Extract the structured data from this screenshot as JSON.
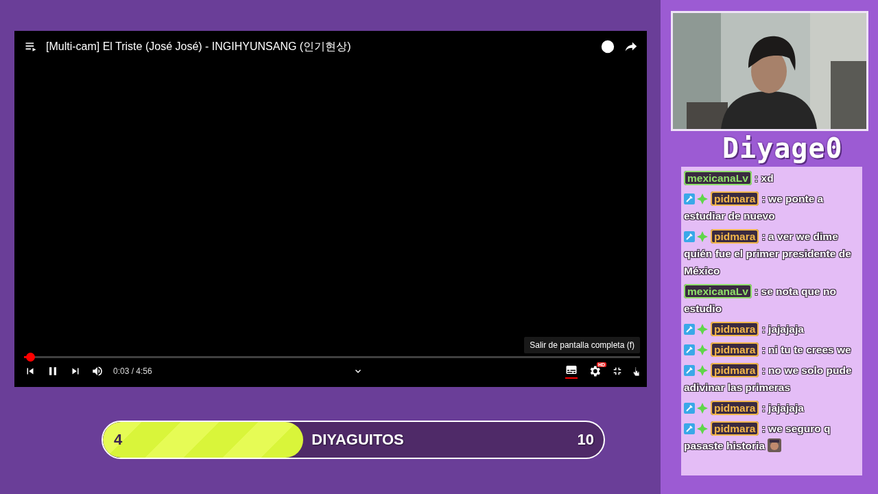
{
  "player": {
    "title": "[Multi-cam] El Triste (José José) - INGIHYUNSANG (인기현상)",
    "tooltip": "Salir de pantalla completa (f)",
    "progress": {
      "level": 0.01
    },
    "time": "0:03 / 4:56",
    "paused": false,
    "subtitles_on": true,
    "quality_badge": "HD"
  },
  "goal": {
    "current": "4",
    "label": "DIYAGUITOS",
    "target": "10",
    "level": 0.4
  },
  "logo": "Diyage0",
  "chat": [
    {
      "badges": false,
      "user": "mexicanaLv",
      "color": "#8fe06a",
      "sep": ":",
      "text": "xd"
    },
    {
      "badges": true,
      "user": "pidmara",
      "color": "#f2b64a",
      "sep": ":",
      "text": "we ponte a estudiar de nuevo"
    },
    {
      "badges": true,
      "user": "pidmara",
      "color": "#f2b64a",
      "sep": ":",
      "text": "a ver we dime quién fue el primer presidente de México"
    },
    {
      "badges": false,
      "user": "mexicanaLv",
      "color": "#8fe06a",
      "sep": ":",
      "text": "se nota que no estudio"
    },
    {
      "badges": true,
      "user": "pidmara",
      "color": "#f2b64a",
      "sep": ":",
      "text": "jajajaja"
    },
    {
      "badges": true,
      "user": "pidmara",
      "color": "#f2b64a",
      "sep": ":",
      "text": "ni tu te crees we"
    },
    {
      "badges": true,
      "user": "pidmara",
      "color": "#f2b64a",
      "sep": ":",
      "text": "no we solo pude adivinar las primeras"
    },
    {
      "badges": true,
      "user": "pidmara",
      "color": "#f2b64a",
      "sep": ":",
      "text": "jajajaja"
    },
    {
      "badges": true,
      "user": "pidmara",
      "color": "#f2b64a",
      "sep": ":",
      "text": "we seguro q pasaste historia",
      "emote": true
    }
  ]
}
